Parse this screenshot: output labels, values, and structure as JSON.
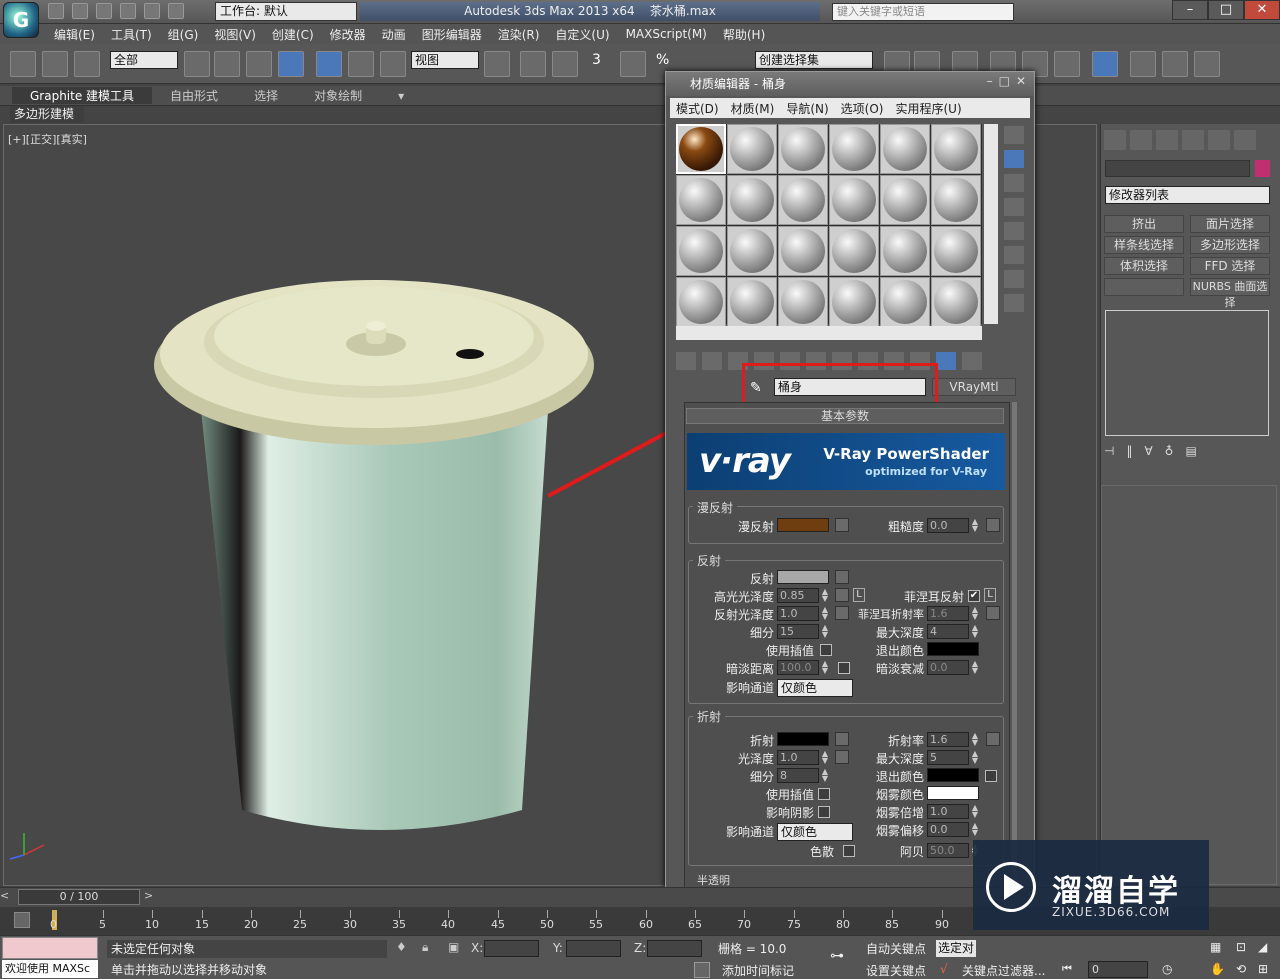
{
  "app": {
    "title": "Autodesk 3ds Max  2013 x64",
    "file": "茶水桶.max",
    "workspace_label": "工作台: 默认",
    "search_placeholder": "键入关键字或短语"
  },
  "menu": [
    "编辑(E)",
    "工具(T)",
    "组(G)",
    "视图(V)",
    "创建(C)",
    "修改器",
    "动画",
    "图形编辑器",
    "渲染(R)",
    "自定义(U)",
    "MAXScript(M)",
    "帮助(H)"
  ],
  "toolbar": {
    "selection_filter": "全部",
    "ref_coord": "视图",
    "named_selection": "创建选择集",
    "angle_snap": "3",
    "percent_snap": "%"
  },
  "ribbon": {
    "tabs": [
      "Graphite 建模工具",
      "自由形式",
      "选择",
      "对象绘制"
    ],
    "sub_tab": "多边形建模"
  },
  "viewport": {
    "label": "[+][正交][真实]"
  },
  "material_editor": {
    "title": "材质编辑器 - 桶身",
    "menu": [
      "模式(D)",
      "材质(M)",
      "导航(N)",
      "选项(O)",
      "实用程序(U)"
    ],
    "material_name": "桶身",
    "material_type": "VRayMtl",
    "rollout_title": "基本参数",
    "vray_banner": {
      "logo": "v·ray",
      "title": "V-Ray PowerShader",
      "subtitle": "optimized for V-Ray"
    },
    "diffuse_group": {
      "title": "漫反射",
      "diffuse_label": "漫反射",
      "roughness_label": "粗糙度",
      "roughness": "0.0",
      "diffuse_color": "#6e3d10"
    },
    "reflection_group": {
      "title": "反射",
      "reflect_label": "反射",
      "reflect_color": "#a8a8a8",
      "hilight_label": "高光光泽度",
      "hilight": "0.85",
      "l_label": "L",
      "fresnel_label": "菲涅耳反射",
      "fresnel_checked": "✔",
      "refl_gloss_label": "反射光泽度",
      "refl_gloss": "1.0",
      "fresnel_ior_label": "菲涅耳折射率",
      "fresnel_ior": "1.6",
      "subdivs_label": "细分",
      "subdivs": "15",
      "max_depth_label": "最大深度",
      "max_depth": "4",
      "interp_label": "使用插值",
      "exit_color_label": "退出颜色",
      "dim_dist_label": "暗淡距离",
      "dim_dist": "100.0",
      "dim_falloff_label": "暗淡衰减",
      "dim_falloff": "0.0",
      "affect_label": "影响通道",
      "affect_value": "仅颜色"
    },
    "refraction_group": {
      "title": "折射",
      "refract_label": "折射",
      "ior_label": "折射率",
      "ior": "1.6",
      "gloss_label": "光泽度",
      "gloss": "1.0",
      "max_depth_label": "最大深度",
      "max_depth": "5",
      "subdivs_label": "细分",
      "subdivs": "8",
      "exit_color_label": "退出颜色",
      "interp_label": "使用插值",
      "fog_color_label": "烟雾颜色",
      "shadows_label": "影响阴影",
      "fog_mult_label": "烟雾倍增",
      "fog_mult": "1.0",
      "affect_label": "影响通道",
      "affect_value": "仅颜色",
      "fog_bias_label": "烟雾偏移",
      "fog_bias": "0.0",
      "dispersion_label": "色散",
      "abbe_label": "阿贝",
      "abbe": "50.0"
    },
    "next_group": "半透明"
  },
  "command_panel": {
    "modifier_list": "修改器列表",
    "buttons": [
      "挤出",
      "面片选择",
      "样条线选择",
      "多边形选择",
      "体积选择",
      "FFD 选择",
      "",
      "NURBS 曲面选择"
    ]
  },
  "timeline": {
    "frame": "0 / 100",
    "ticks": [
      "0",
      "5",
      "10",
      "15",
      "20",
      "25",
      "30",
      "35",
      "40",
      "45",
      "50",
      "55",
      "60",
      "65",
      "70",
      "75",
      "80",
      "85",
      "90"
    ]
  },
  "status": {
    "listener": "欢迎使用 MAXSc",
    "selection": "未选定任何对象",
    "prompt": "单击并拖动以选择并移动对象",
    "x_label": "X:",
    "y_label": "Y:",
    "z_label": "Z:",
    "grid": "栅格 = 10.0",
    "auto_key": "自动关键点",
    "set_key": "设置关键点",
    "selected": "选定对",
    "add_time_tag": "添加时间标记",
    "key_filters": "关键点过滤器...",
    "frame_field": "0"
  },
  "watermark": {
    "brand": "溜溜自学",
    "url": "ZIXUE.3D66.COM"
  }
}
